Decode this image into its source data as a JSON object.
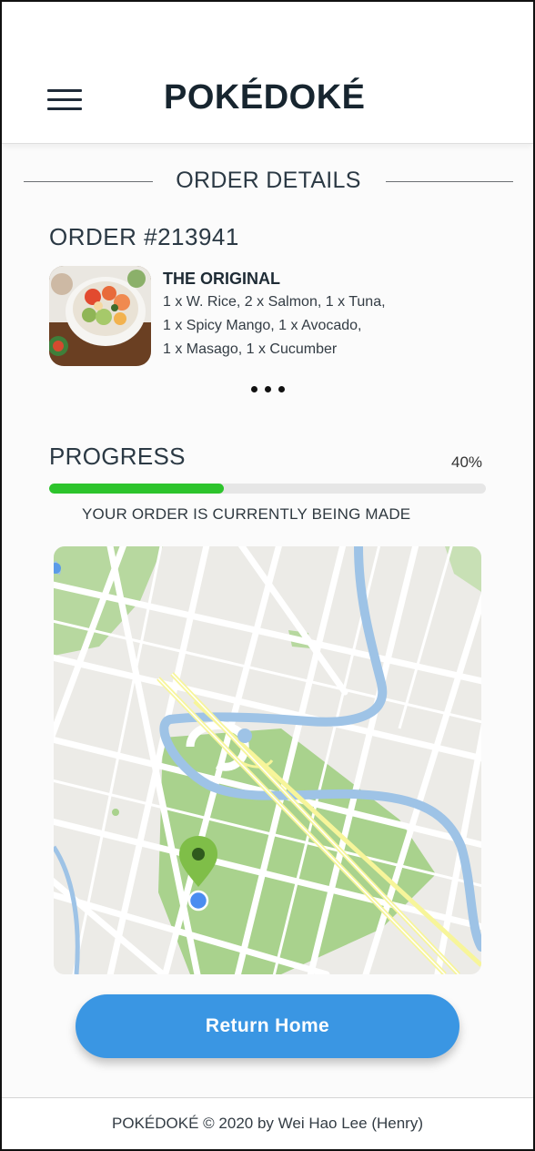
{
  "header": {
    "brand": "POKÉDOKÉ",
    "menu_icon": "hamburger-menu-icon"
  },
  "order": {
    "section_title": "ORDER DETAILS",
    "number": "ORDER #213941",
    "item": {
      "name": "THE ORIGINAL",
      "description_lines": [
        "1 x W. Rice, 2 x Salmon, 1 x Tuna,",
        "1 x Spicy Mango, 1 x Avocado,",
        "1 x Masago, 1 x Cucumber"
      ],
      "image": "poke-bowl-photo"
    },
    "more_icon": "more-dots-icon"
  },
  "progress": {
    "label": "PROGRESS",
    "percent_text": "40%",
    "value": 0.4,
    "status": "YOUR ORDER IS CURRENTLY BEING MADE",
    "bar_color": "#2dc42c"
  },
  "map": {
    "pin_icon": "location-pin-icon",
    "marker_icon": "current-location-dot-icon",
    "colors": {
      "park": "#a7d18a",
      "water": "#9ec3e6",
      "highway": "#f7f59a",
      "road": "#ffffff",
      "land": "#ecebe7"
    }
  },
  "actions": {
    "return_home": "Return Home",
    "button_color": "#3a96e3"
  },
  "footer": {
    "text": "POKÉDOKÉ © 2020 by Wei Hao Lee (Henry)"
  }
}
